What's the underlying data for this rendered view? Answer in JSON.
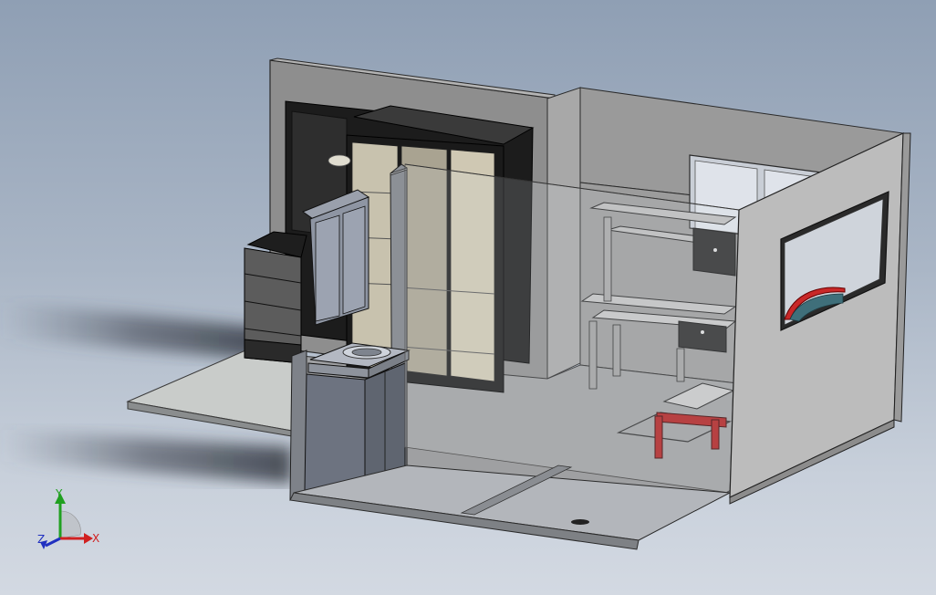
{
  "viewport": {
    "background_top": "#8f9fb4",
    "background_bottom": "#d3d9e2"
  },
  "triad": {
    "x_label": "X",
    "y_label": "Y",
    "z_label": "Z",
    "x_color": "#d02020",
    "y_color": "#20a020",
    "z_color": "#2030c0"
  },
  "model": {
    "accent_chair": "#b01f1f",
    "accent_sign": "#c82828"
  }
}
